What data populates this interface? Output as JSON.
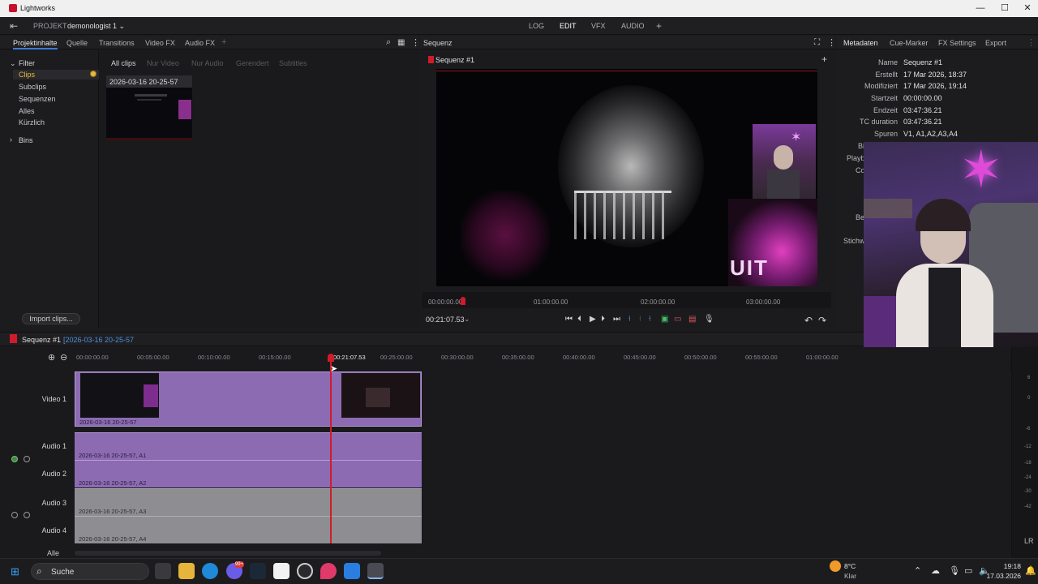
{
  "titlebar": {
    "title": "Lightworks",
    "min": "—",
    "max": "☐",
    "close": "✕"
  },
  "topbar": {
    "project_label": "PROJEKT",
    "project_name": "demonologist 1 ⌄",
    "tabs": [
      "LOG",
      "EDIT",
      "VFX",
      "AUDIO"
    ],
    "add": "+"
  },
  "left_tabs": [
    "Projektinhalte",
    "Quelle",
    "Transitions",
    "Video FX",
    "Audio FX"
  ],
  "left_tab_add": "+",
  "sidebar": {
    "filter": "Filter",
    "items": [
      "Clips",
      "Subclips",
      "Sequenzen",
      "Alles",
      "Kürzlich"
    ],
    "bins": "Bins",
    "import": "Import clips..."
  },
  "filter_tabs": [
    "All clips",
    "Nur Video",
    "Nur Audio",
    "Gerendert",
    "Subtitles"
  ],
  "clip": {
    "name": "2026-03-16 20-25-57"
  },
  "sequence_panel": {
    "title": "Sequenz",
    "seq_name": "Sequenz #1",
    "add": "+"
  },
  "viewer": {
    "ruler": [
      "00:00:00.00",
      "01:00:00.00",
      "02:00:00.00",
      "03:00:00.00"
    ],
    "timecode": "00:21:07.53",
    "timecode_caret": "⌄"
  },
  "meta_tabs": [
    "Metadaten",
    "Cue-Marker",
    "FX Settings",
    "Export"
  ],
  "metadata": [
    {
      "key": "Name",
      "value": "Sequenz #1"
    },
    {
      "key": "Erstellt",
      "value": "17 Mar 2026, 18:37"
    },
    {
      "key": "Modifiziert",
      "value": "17 Mar 2026, 19:14"
    },
    {
      "key": "Startzeit",
      "value": "00:00:00.00"
    },
    {
      "key": "Endzeit",
      "value": "03:47:36.21"
    },
    {
      "key": "TC duration",
      "value": "03:47:36.21"
    },
    {
      "key": "Spuren",
      "value": "V1, A1,A2,A3,A4"
    }
  ],
  "meta_partial": [
    "Bi",
    "Playb",
    "Co",
    "Be",
    "Stichw"
  ],
  "timeline": {
    "seq_name": "Sequenz #1",
    "source": "[2026-03-16 20-25-57",
    "ticks": [
      "00:00:00.00",
      "00:05:00.00",
      "00:10:00.00",
      "00:15:00.00",
      "00:21:07.53",
      "00:25:00.00",
      "00:30:00.00",
      "00:35:00.00",
      "00:40:00.00",
      "00:45:00.00",
      "00:50:00.00",
      "00:55:00.00",
      "01:00:00.00"
    ],
    "tracks": {
      "video1": "Video 1",
      "audio1": "Audio 1",
      "audio2": "Audio 2",
      "audio3": "Audio 3",
      "audio4": "Audio 4",
      "all": "Alle"
    },
    "clips": {
      "v1": "2026-03-16 20-25-57",
      "a1": "2026-03-16 20-25-57, A1",
      "a2": "2026-03-16 20-25-57, A2",
      "a3": "2026-03-16 20-25-57, A3",
      "a4": "2026-03-16 20-25-57, A4"
    },
    "meter_labels": [
      "6",
      "0",
      "-6",
      "-12",
      "-18",
      "-24",
      "-30",
      "-42"
    ],
    "lr": "LR"
  },
  "taskbar": {
    "search": "Suche",
    "weather_temp": "8°C",
    "weather_text": "Klar",
    "time": "19:18",
    "date": "17.03.2026",
    "badge": "99+"
  },
  "colors": {
    "accent": "#3b7bd4",
    "clip_purple": "#8c6bb2",
    "playhead": "#d11b2a",
    "selected": "#e8b93a"
  }
}
